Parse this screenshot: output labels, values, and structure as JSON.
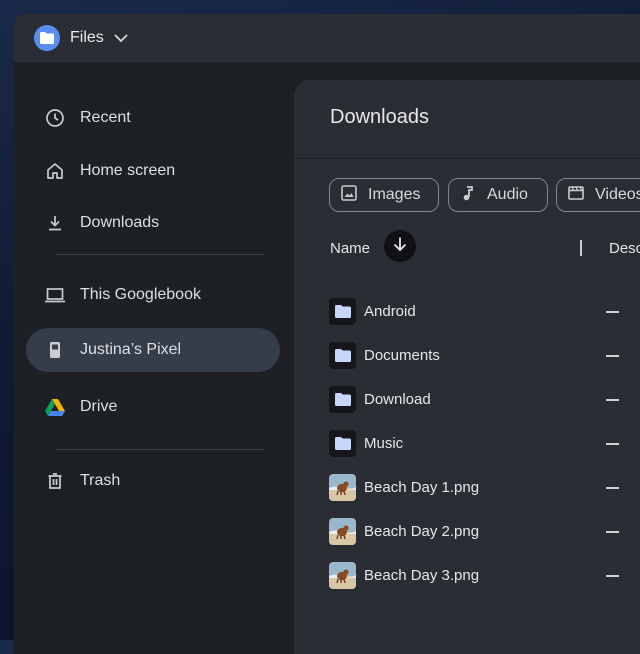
{
  "app": {
    "title": "Files",
    "icon": "folder-icon",
    "brand_color": "#5b8def"
  },
  "sidebar": {
    "items": [
      {
        "label": "Recent",
        "icon": "clock-icon"
      },
      {
        "label": "Home screen",
        "icon": "home-icon"
      },
      {
        "label": "Downloads",
        "icon": "download-icon"
      },
      {
        "label": "This Googlebook",
        "icon": "laptop-icon"
      },
      {
        "label": "Justina’s Pixel",
        "icon": "phone-icon",
        "selected": true
      },
      {
        "label": "Drive",
        "icon": "drive-icon"
      },
      {
        "label": "Trash",
        "icon": "trash-icon"
      }
    ]
  },
  "main": {
    "title": "Downloads",
    "filters": [
      {
        "label": "Images",
        "icon": "image-icon"
      },
      {
        "label": "Audio",
        "icon": "music-note-icon"
      },
      {
        "label": "Videos",
        "icon": "video-icon"
      }
    ],
    "columns": {
      "name": "Name",
      "desc": "Desc",
      "sort": "descending"
    },
    "files": [
      {
        "name": "Android",
        "type": "folder",
        "desc": "—"
      },
      {
        "name": "Documents",
        "type": "folder",
        "desc": "—"
      },
      {
        "name": "Download",
        "type": "folder",
        "desc": "—"
      },
      {
        "name": "Music",
        "type": "folder",
        "desc": "—"
      },
      {
        "name": "Beach Day 1.png",
        "type": "image",
        "desc": "—"
      },
      {
        "name": "Beach Day 2.png",
        "type": "image",
        "desc": "—"
      },
      {
        "name": "Beach Day 3.png",
        "type": "image",
        "desc": "—"
      }
    ]
  }
}
